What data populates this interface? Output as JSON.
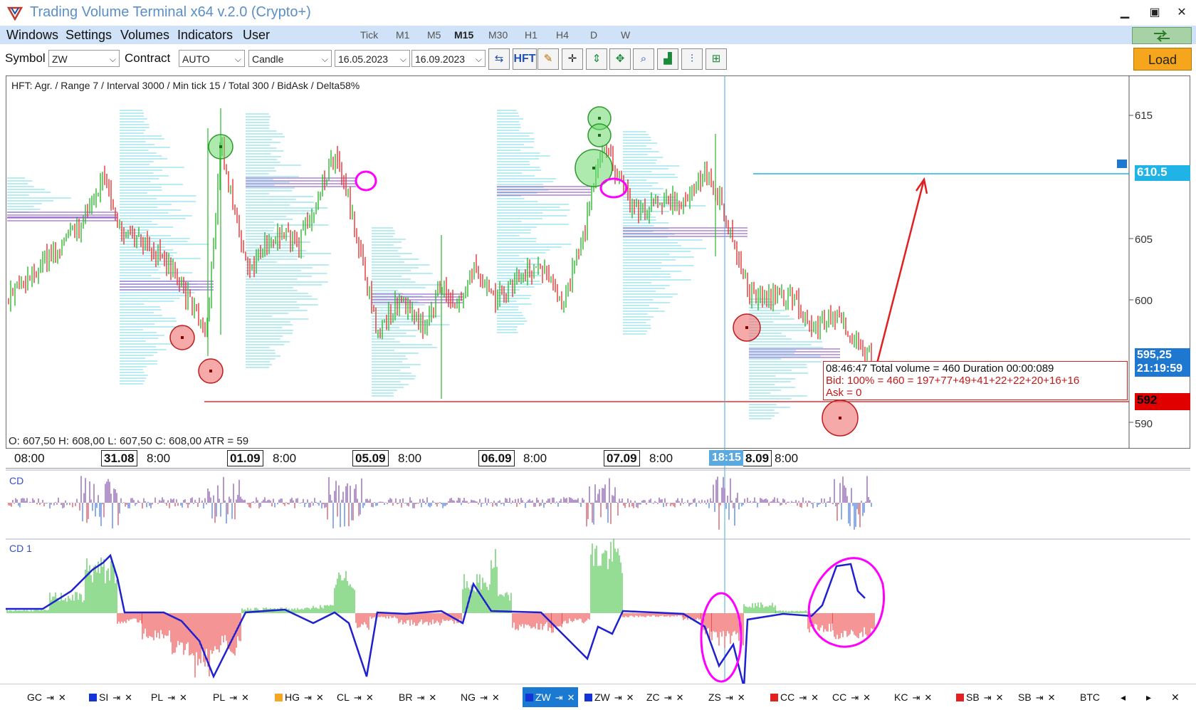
{
  "window": {
    "title": "Trading Volume Terminal x64 v.2.0 (Crypto+)",
    "controls": {
      "minimize": "▁",
      "maximize": "▣",
      "close": "✕"
    }
  },
  "menu": {
    "items": [
      "Windows",
      "Settings",
      "Volumes",
      "Indicators",
      "User"
    ],
    "timeframes": [
      "Tick",
      "M1",
      "M5",
      "M15",
      "M30",
      "H1",
      "H4",
      "D",
      "W"
    ],
    "active_timeframe": "M15",
    "sync_icon": "sync-arrows-icon"
  },
  "toolbar": {
    "symbol_label": "Symbol",
    "symbol_value": "ZW",
    "contract_label": "Contract",
    "contract_value": "AUTO",
    "chart_type": "Candle",
    "date_from": "16.05.2023",
    "date_to": "16.09.2023",
    "hft_label": "HFT",
    "load_label": "Load",
    "tools": [
      "arrows-icon",
      "hft-icon",
      "pencil-icon",
      "crosshair-icon",
      "vertical-scale-icon",
      "fit-icon",
      "zoom-icon",
      "bars-icon",
      "delta-bars-icon",
      "range-icon"
    ]
  },
  "chart": {
    "caption": "HFT: Agr. / Range 7 / Interval 3000 / Min tick 15 / Total 300 / BidAsk / Delta58%",
    "ohlc": "O: 607,50   H: 608,00   L: 607,50   C: 608,00   ATR = 59",
    "price_ticks": [
      "615",
      "605",
      "600",
      "590"
    ],
    "level_price": "610.5",
    "last_price": "595,25",
    "last_time": "21:19:59",
    "red_level": "592",
    "tooltip": {
      "line1": "08:46:47  Total volume = 460  Duration 00:00:089",
      "line2": "Bid:  100% = 460 = 197+77+49+41+22+22+20+16+16",
      "line3": "Ask = 0"
    },
    "colors": {
      "bull": "#2db82d",
      "bear": "#e63232",
      "profile": "#8fe3ea",
      "poc": "#9966cc",
      "level": "#1fb3e6",
      "marker": "#ff00ff"
    }
  },
  "time_axis": {
    "first_label": "08:00",
    "dates": [
      "31.08",
      "01.09",
      "05.09",
      "06.09",
      "07.09"
    ],
    "hour_label": "8:00",
    "cursor_time": "18:15",
    "partial_date": "8.09"
  },
  "panels": {
    "cd_label": "CD",
    "cd1_label": "CD 1"
  },
  "tabs": [
    {
      "label": "GC",
      "color": ""
    },
    {
      "label": "SI",
      "color": "#1434d8"
    },
    {
      "label": "PL",
      "color": ""
    },
    {
      "label": "PL",
      "color": ""
    },
    {
      "label": "HG",
      "color": "#f5a623"
    },
    {
      "label": "CL",
      "color": ""
    },
    {
      "label": "BR",
      "color": ""
    },
    {
      "label": "NG",
      "color": ""
    },
    {
      "label": "ZW",
      "color": "#1434d8",
      "active": true
    },
    {
      "label": "ZW",
      "color": "#1434d8"
    },
    {
      "label": "ZC",
      "color": ""
    },
    {
      "label": "ZS",
      "color": ""
    },
    {
      "label": "CC",
      "color": "#e32020"
    },
    {
      "label": "CC",
      "color": ""
    },
    {
      "label": "KC",
      "color": ""
    },
    {
      "label": "SB",
      "color": "#e32020"
    },
    {
      "label": "SB",
      "color": ""
    },
    {
      "label": "BTC",
      "color": ""
    }
  ],
  "tab_controls": {
    "pin": "⇥",
    "close": "✕"
  },
  "tab_nav": {
    "prev": "◂",
    "next": "▸",
    "close": "✕"
  }
}
